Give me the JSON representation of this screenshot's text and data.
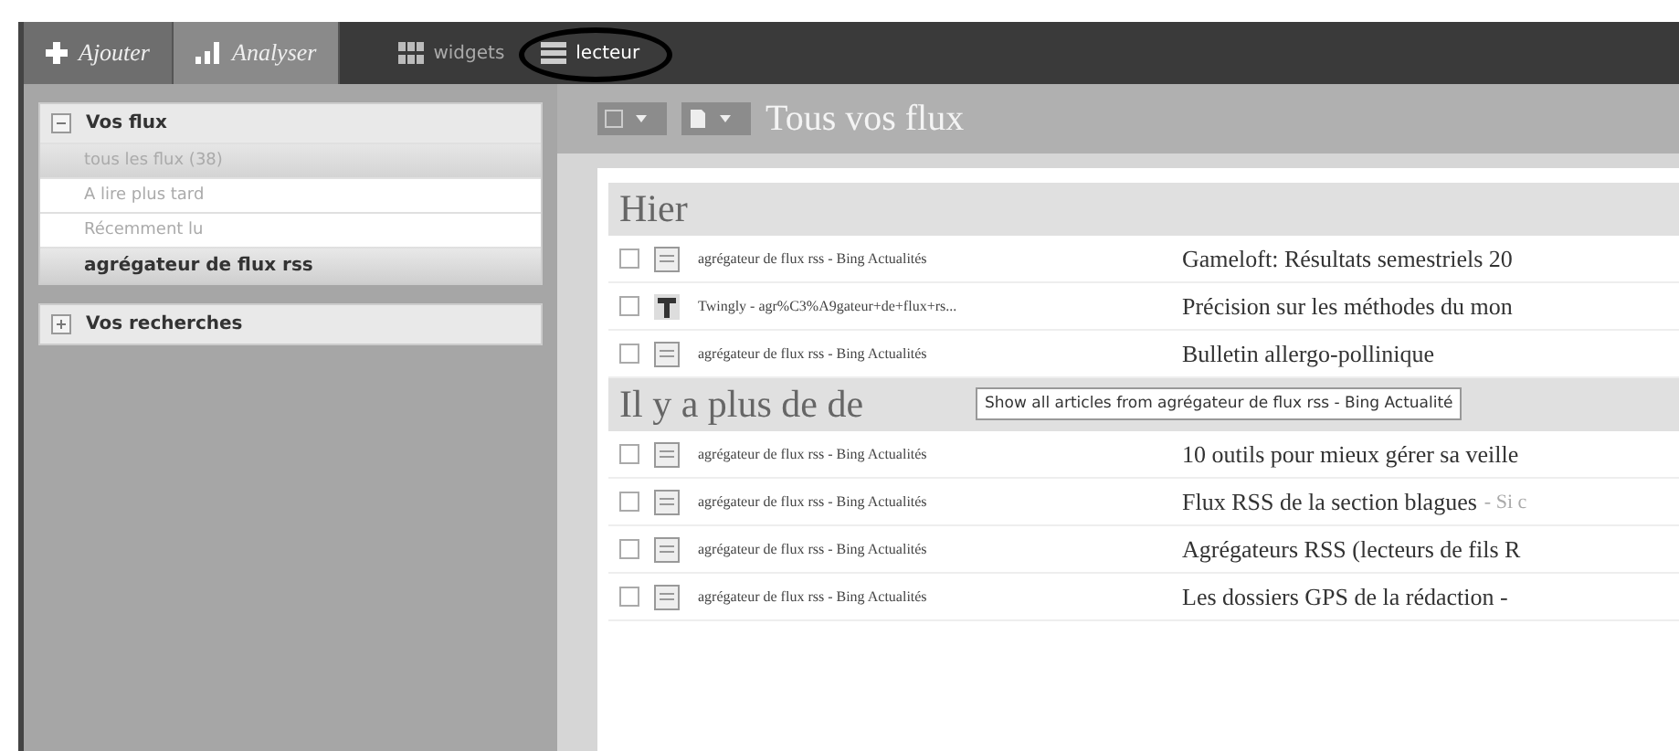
{
  "toolbar": {
    "buttons": [
      {
        "label": "Ajouter",
        "kind": "add",
        "selected": false
      },
      {
        "label": "Analyser",
        "kind": "analyse",
        "selected": true
      }
    ],
    "views": [
      {
        "label": "widgets",
        "kind": "widgets",
        "selected": false,
        "circled": false
      },
      {
        "label": "lecteur",
        "kind": "reader",
        "selected": true,
        "circled": true
      }
    ]
  },
  "sidebar": {
    "panels": [
      {
        "title": "Vos flux",
        "expanded": true,
        "items": [
          {
            "label": "tous les flux (38)",
            "selected": true,
            "bold": false
          },
          {
            "label": "A lire plus tard",
            "selected": false,
            "bold": false
          },
          {
            "label": "Récemment lu",
            "selected": false,
            "bold": false
          },
          {
            "label": "agrégateur de flux rss",
            "selected": false,
            "bold": true
          }
        ]
      },
      {
        "title": "Vos recherches",
        "expanded": false
      }
    ]
  },
  "header": {
    "title": "Tous vos flux"
  },
  "sections": [
    {
      "title": "Hier",
      "rows": [
        {
          "checked": false,
          "kind": "feed",
          "source": "agrégateur de flux rss - Bing Actualités",
          "title": "Gameloft: Résultats semestriels 20"
        },
        {
          "checked": false,
          "kind": "blog",
          "source": "Twingly - agr%C3%A9gateur+de+flux+rs...",
          "title": "Précision sur les méthodes du mon"
        },
        {
          "checked": false,
          "kind": "feed",
          "source": "agrégateur de flux rss - Bing Actualités",
          "title": "Bulletin allergo-pollinique"
        }
      ]
    },
    {
      "title": "Il y a plus de de",
      "rows": [
        {
          "checked": false,
          "kind": "feed",
          "source": "agrégateur de flux rss - Bing Actualités",
          "title": "10 outils pour mieux gérer sa veille"
        },
        {
          "checked": false,
          "kind": "feed",
          "source": "agrégateur de flux rss - Bing Actualités",
          "title": "Flux RSS de la section blagues",
          "snippet": "- Si c"
        },
        {
          "checked": false,
          "kind": "feed",
          "source": "agrégateur de flux rss - Bing Actualités",
          "title": "Agrégateurs RSS (lecteurs de fils R"
        },
        {
          "checked": false,
          "kind": "feed",
          "source": "agrégateur de flux rss - Bing Actualités",
          "title": "Les dossiers GPS de la rédaction -"
        }
      ]
    }
  ],
  "tooltip": {
    "text": "Show all articles from agrégateur de flux rss - Bing Actualité"
  }
}
